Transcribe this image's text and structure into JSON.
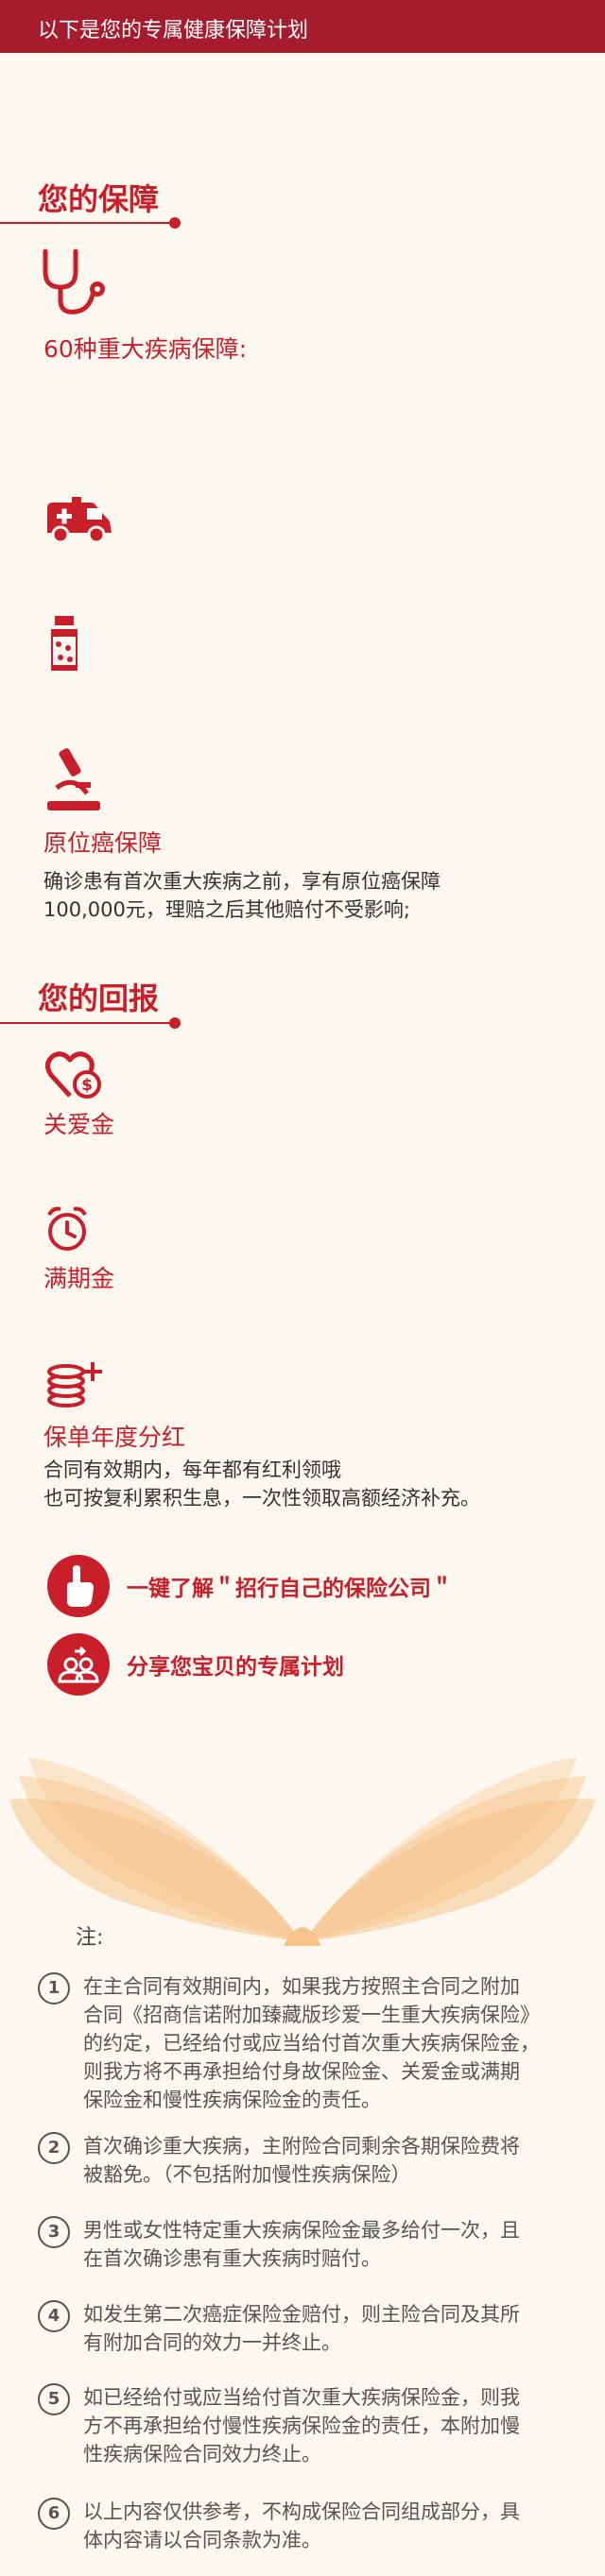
{
  "header": {
    "title": "以下是您的专属健康保障计划"
  },
  "protection": {
    "title": "您的保障",
    "critical": {
      "label": "60种重大疾病保障:"
    },
    "in_situ": {
      "label": "原位癌保障",
      "desc_line1": "确诊患有首次重大疾病之前，享有原位癌保障",
      "desc_line2": "100,000元，理赔之后其他赔付不受影响;"
    }
  },
  "returns": {
    "title": "您的回报",
    "care": {
      "label": "关爱金"
    },
    "maturity": {
      "label": "满期金"
    },
    "dividend": {
      "label": "保单年度分红",
      "desc_line1": "合同有效期内，每年都有红利领哦",
      "desc_line2": "也可按复利累积生息，一次性领取高额经济补充。"
    }
  },
  "actions": {
    "learn": "一键了解＂招行自己的保险公司＂",
    "share": "分享您宝贝的专属计划"
  },
  "notes": {
    "title": "注:",
    "items": [
      {
        "num": "1",
        "lines": [
          "在主合同有效期间内，如果我方按照主合同之附加",
          "合同《招商信诺附加臻藏版珍爱一生重大疾病保险》",
          "的约定，已经给付或应当给付首次重大疾病保险金，",
          "则我方将不再承担给付身故保险金、关爱金或满期",
          "保险金和慢性疾病保险金的责任。"
        ]
      },
      {
        "num": "2",
        "lines": [
          "首次确诊重大疾病，主附险合同剩余各期保险费将",
          "被豁免。（不包括附加慢性疾病保险）"
        ]
      },
      {
        "num": "3",
        "lines": [
          "男性或女性特定重大疾病保险金最多给付一次，且",
          "在首次确诊患有重大疾病时赔付。"
        ]
      },
      {
        "num": "4",
        "lines": [
          "如发生第二次癌症保险金赔付，则主险合同及其所",
          "有附加合同的效力一并终止。"
        ]
      },
      {
        "num": "5",
        "lines": [
          "如已经给付或应当给付首次重大疾病保险金，则我",
          "方不再承担给付慢性疾病保险金的责任，本附加慢",
          "性疾病保险合同效力终止。"
        ]
      },
      {
        "num": "6",
        "lines": [
          "以上内容仅供参考，不构成保险合同组成部分，具",
          "体内容请以合同条款为准。"
        ]
      }
    ]
  },
  "colors": {
    "brand": "#c91f2b",
    "header": "#a51d2d",
    "background": "#fdf8ef",
    "wing": "#f6c48a"
  },
  "icons": [
    "stethoscope-icon",
    "ambulance-icon",
    "medicine-bottle-icon",
    "microscope-icon",
    "heart-coin-icon",
    "alarm-clock-icon",
    "coin-stack-icon",
    "pointing-hand-icon",
    "share-people-icon"
  ]
}
